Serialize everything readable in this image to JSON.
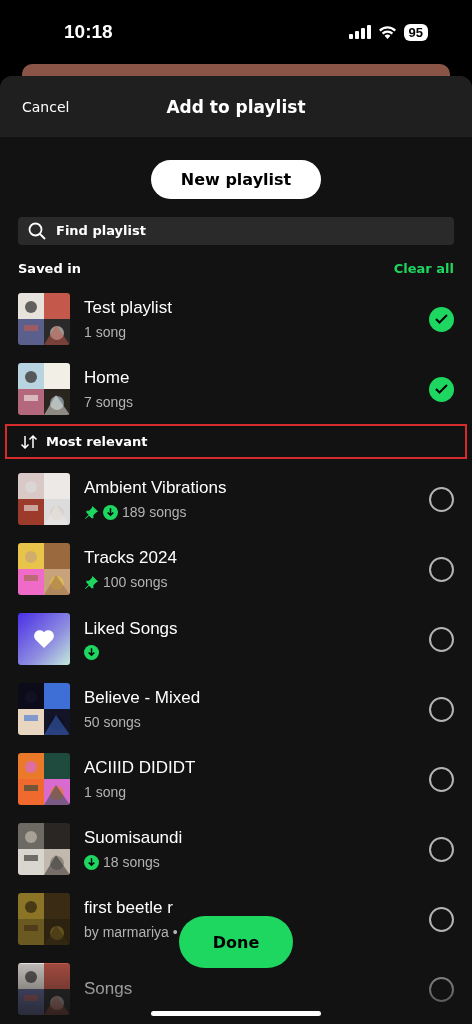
{
  "status_bar": {
    "time": "10:18",
    "battery": "95"
  },
  "header": {
    "cancel": "Cancel",
    "title": "Add to playlist"
  },
  "new_playlist_button": "New playlist",
  "search": {
    "placeholder": "Find playlist"
  },
  "saved_in": {
    "label": "Saved in",
    "action": "Clear all"
  },
  "saved_playlists": [
    {
      "title": "Test playlist",
      "subtitle": "1 song",
      "kind": "picture",
      "pinned": false,
      "downloaded": false,
      "selected": true
    },
    {
      "title": "Home",
      "subtitle": "7 songs",
      "kind": "picture",
      "pinned": false,
      "downloaded": false,
      "selected": true
    }
  ],
  "sort": {
    "label": "Most relevant",
    "highlighted": true
  },
  "playlists": [
    {
      "title": "Ambient Vibrations",
      "subtitle": "189 songs",
      "kind": "picture",
      "pinned": true,
      "downloaded": true,
      "selected": false
    },
    {
      "title": "Tracks 2024",
      "subtitle": "100 songs",
      "kind": "picture",
      "pinned": true,
      "downloaded": false,
      "selected": false
    },
    {
      "title": "Liked Songs",
      "kind": "liked",
      "pinned": false,
      "downloaded": true,
      "selected": false
    },
    {
      "title": "Believe - Mixed",
      "subtitle": "50 songs",
      "kind": "picture",
      "pinned": false,
      "downloaded": false,
      "selected": false
    },
    {
      "title": "ACIIID DIDIDT",
      "subtitle": "1 song",
      "kind": "picture",
      "pinned": false,
      "downloaded": false,
      "selected": false
    },
    {
      "title": "Suomisaundi",
      "subtitle": "18 songs",
      "kind": "picture",
      "pinned": false,
      "downloaded": true,
      "selected": false
    },
    {
      "title": "first beetle r",
      "subtitle": "by marmariya •",
      "kind": "picture",
      "pinned": false,
      "downloaded": false,
      "selected": false
    },
    {
      "title": "Songs",
      "kind": "picture",
      "pinned": false,
      "downloaded": false,
      "selected": false
    }
  ],
  "done_button": "Done"
}
